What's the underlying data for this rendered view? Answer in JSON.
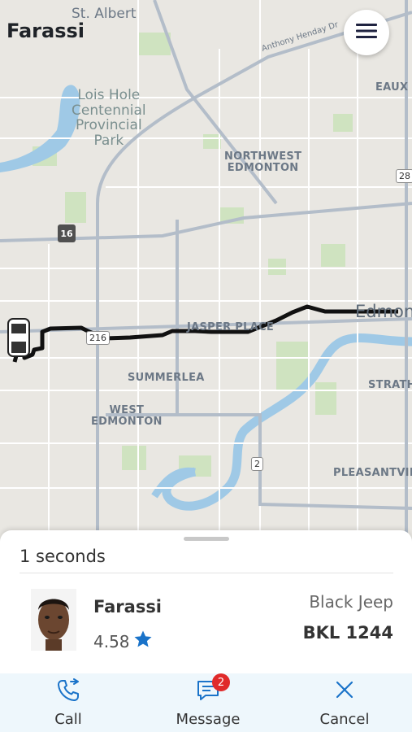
{
  "app": {
    "title": "Farassi"
  },
  "map": {
    "labels": {
      "st_albert": "St. Albert",
      "lois_hole": "Lois Hole\nCentennial\nProvincial\nPark",
      "northwest_edmonton": "NORTHWEST\nEDMONTON",
      "eaux_claires": "EAUX C",
      "jasper_place": "JASPER PLACE",
      "summerlea": "SUMMERLEA",
      "west_edmonton": "WEST\nEDMONTON",
      "strathearn": "STRATH",
      "pleasantview": "PLEASANTVIEW",
      "edmonton": "Edmon",
      "anthony_henday": "Anthony Henday Dr"
    },
    "shields": {
      "hwy16": "16",
      "hwy216": "216",
      "hwy2": "2",
      "hwy28": "28"
    },
    "colors": {
      "route": "#111111",
      "water": "#9fc9e6",
      "park": "#cfe3c0",
      "road": "#ffffff",
      "major_road": "#a6b2c0"
    }
  },
  "trip": {
    "eta_text": "1 seconds",
    "driver": {
      "name": "Farassi",
      "rating": "4.58",
      "rating_icon": "star-icon"
    },
    "car": {
      "model": "Black Jeep",
      "plate": "BKL 1244"
    }
  },
  "actions": {
    "call": {
      "label": "Call",
      "icon": "phone-icon"
    },
    "message": {
      "label": "Message",
      "icon": "chat-icon",
      "badge": "2"
    },
    "cancel": {
      "label": "Cancel",
      "icon": "close-icon"
    }
  },
  "accent": "#1a73c9"
}
